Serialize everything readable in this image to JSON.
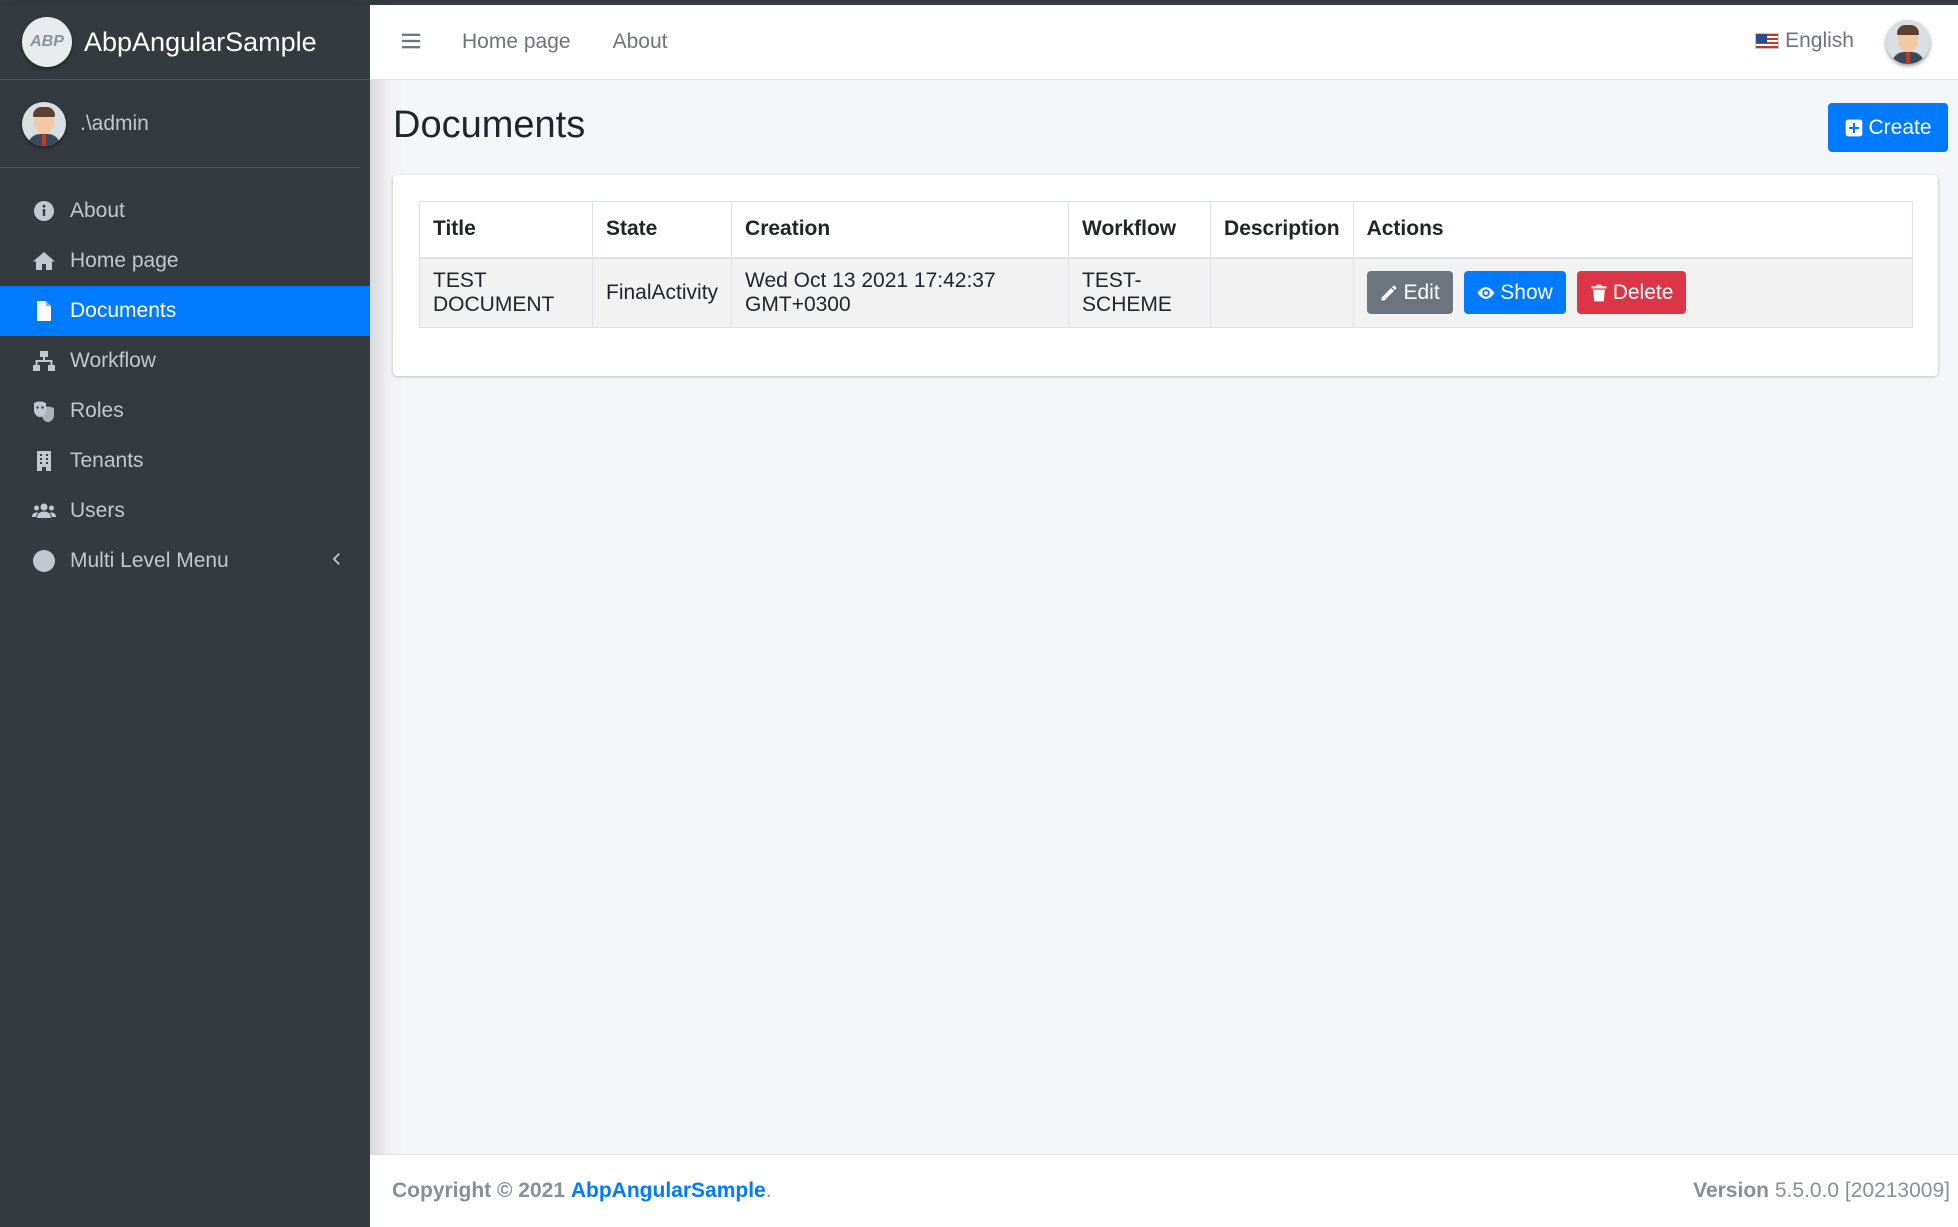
{
  "app": {
    "brand": "AbpAngularSample",
    "logo_text": "ABP"
  },
  "user": {
    "name": ".\\admin"
  },
  "sidebar": {
    "items": [
      {
        "label": "About",
        "icon": "info-circle-icon"
      },
      {
        "label": "Home page",
        "icon": "home-icon"
      },
      {
        "label": "Documents",
        "icon": "file-icon",
        "active": true
      },
      {
        "label": "Workflow",
        "icon": "sitemap-icon"
      },
      {
        "label": "Roles",
        "icon": "theater-masks-icon"
      },
      {
        "label": "Tenants",
        "icon": "building-icon"
      },
      {
        "label": "Users",
        "icon": "users-icon"
      },
      {
        "label": "Multi Level Menu",
        "icon": "circle-icon",
        "expandable": true
      }
    ]
  },
  "topnav": {
    "links": [
      "Home page",
      "About"
    ],
    "language": "English"
  },
  "page": {
    "title": "Documents",
    "create_label": "Create"
  },
  "table": {
    "headers": [
      "Title",
      "State",
      "Creation",
      "Workflow",
      "Description",
      "Actions"
    ],
    "rows": [
      {
        "title": "TEST DOCUMENT",
        "state": "FinalActivity",
        "creation": "Wed Oct 13 2021 17:42:37 GMT+0300",
        "workflow": "TEST-SCHEME",
        "description": "",
        "actions": {
          "edit": "Edit",
          "show": "Show",
          "delete": "Delete"
        }
      }
    ]
  },
  "footer": {
    "copyright_prefix": "Copyright © 2021",
    "app_link": "AbpAngularSample",
    "suffix": ".",
    "version_label": "Version",
    "version_value": "5.5.0.0 [20213009]"
  },
  "colors": {
    "sidebar_bg": "#343a40",
    "primary": "#007bff",
    "secondary": "#6c757d",
    "danger": "#dc3545"
  }
}
